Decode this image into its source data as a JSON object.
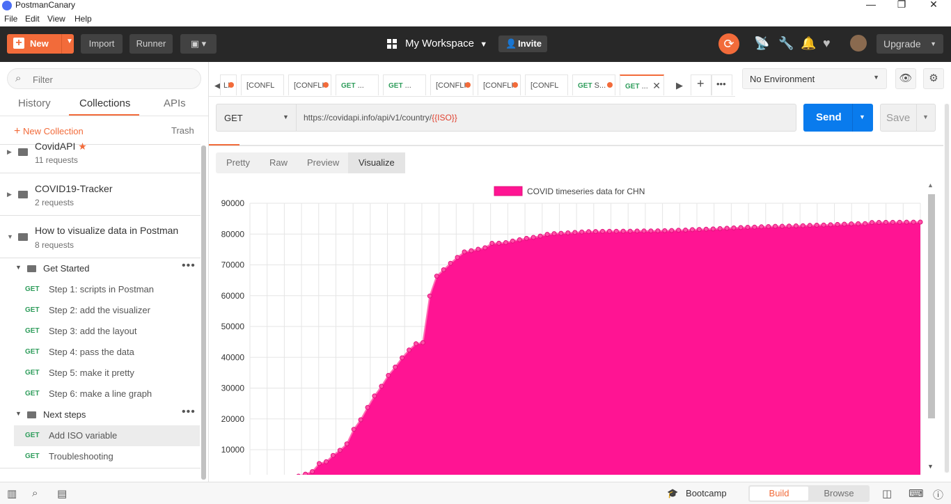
{
  "app": {
    "title": "PostmanCanary"
  },
  "window": {
    "minimize": "—",
    "maximize": "❐",
    "close": "✕"
  },
  "menu": [
    "File",
    "Edit",
    "View",
    "Help"
  ],
  "toolbar": {
    "new_label": "New",
    "import_label": "Import",
    "runner_label": "Runner",
    "workspace_label": "My Workspace",
    "invite_label": "Invite",
    "upgrade_label": "Upgrade"
  },
  "sidebar": {
    "filter_placeholder": "Filter",
    "tabs": [
      "History",
      "Collections",
      "APIs"
    ],
    "active_tab": "Collections",
    "new_collection": "New Collection",
    "trash": "Trash",
    "collections": [
      {
        "name": "CovidAPI",
        "count": "11 requests",
        "starred": true
      },
      {
        "name": "COVID19-Tracker",
        "count": "2 requests",
        "starred": false
      },
      {
        "name": "How to visualize data in Postman",
        "count": "8 requests",
        "starred": false
      }
    ],
    "folders": [
      {
        "name": "Get Started",
        "requests": [
          {
            "method": "GET",
            "name": "Step 1: scripts in Postman"
          },
          {
            "method": "GET",
            "name": "Step 2: add the visualizer"
          },
          {
            "method": "GET",
            "name": "Step 3: add the layout"
          },
          {
            "method": "GET",
            "name": "Step 4: pass the data"
          },
          {
            "method": "GET",
            "name": "Step 5: make it pretty"
          },
          {
            "method": "GET",
            "name": "Step 6: make a line graph"
          }
        ]
      },
      {
        "name": "Next steps",
        "requests": [
          {
            "method": "GET",
            "name": "Add ISO variable",
            "selected": true
          },
          {
            "method": "GET",
            "name": "Troubleshooting"
          }
        ]
      }
    ]
  },
  "request_tabs": [
    {
      "label": "LI",
      "method": "",
      "dot": true
    },
    {
      "label": "[CONFL",
      "method": "",
      "dot": false
    },
    {
      "label": "[CONFLI",
      "method": "",
      "dot": true
    },
    {
      "label": "...",
      "method": "GET",
      "dot": false
    },
    {
      "label": "...",
      "method": "GET",
      "dot": false
    },
    {
      "label": "[CONFLI",
      "method": "",
      "dot": true
    },
    {
      "label": "[CONFLI",
      "method": "",
      "dot": true
    },
    {
      "label": "[CONFL",
      "method": "",
      "dot": false
    },
    {
      "label": "S...",
      "method": "GET",
      "dot": true
    },
    {
      "label": "...",
      "method": "GET",
      "dot": false,
      "active": true
    }
  ],
  "environment": {
    "selected": "No Environment"
  },
  "request": {
    "method": "GET",
    "url_base": "https://covidapi.info/api/v1/country/",
    "url_var": "{{ISO}}",
    "send_label": "Send",
    "save_label": "Save"
  },
  "response_tabs": [
    "Pretty",
    "Raw",
    "Preview",
    "Visualize"
  ],
  "response_active_tab": "Visualize",
  "footer": {
    "bootcamp": "Bootcamp",
    "build": "Build",
    "browse": "Browse"
  },
  "colors": {
    "accent": "#f26b3a",
    "send": "#097bed",
    "chart_fill": "#ff1493",
    "get": "#2f9d5c"
  },
  "chart_data": {
    "type": "area",
    "title": "",
    "legend": [
      "COVID timeseries data for CHN"
    ],
    "legend_position": "top",
    "grid": true,
    "ylim": [
      0,
      90000
    ],
    "yticks": [
      10000,
      20000,
      30000,
      40000,
      50000,
      60000,
      70000,
      80000,
      90000
    ],
    "series": [
      {
        "name": "COVID timeseries data for CHN",
        "values": [
          548,
          643,
          920,
          1406,
          2075,
          2877,
          5509,
          6087,
          8141,
          9802,
          11891,
          16630,
          19716,
          23707,
          27440,
          30587,
          34110,
          36814,
          39829,
          42354,
          44386,
          44759,
          59895,
          66358,
          68413,
          70513,
          72434,
          74211,
          74619,
          75077,
          75550,
          77001,
          77022,
          77241,
          77754,
          78166,
          78600,
          78928,
          79356,
          79932,
          80136,
          80261,
          80386,
          80537,
          80690,
          80770,
          80823,
          80860,
          80887,
          80921,
          80932,
          80945,
          80977,
          81003,
          81033,
          81058,
          81102,
          81156,
          81250,
          81305,
          81435,
          81498,
          81591,
          81661,
          81782,
          81897,
          81999,
          82122,
          82198,
          82279,
          82361,
          82432,
          82511,
          82543,
          82602,
          82665,
          82718,
          82809,
          82883,
          82941,
          83014,
          83134,
          83213,
          83306,
          83356,
          83403,
          83760,
          83787,
          83805,
          83817,
          83853,
          83868,
          83884,
          83899
        ]
      }
    ]
  }
}
